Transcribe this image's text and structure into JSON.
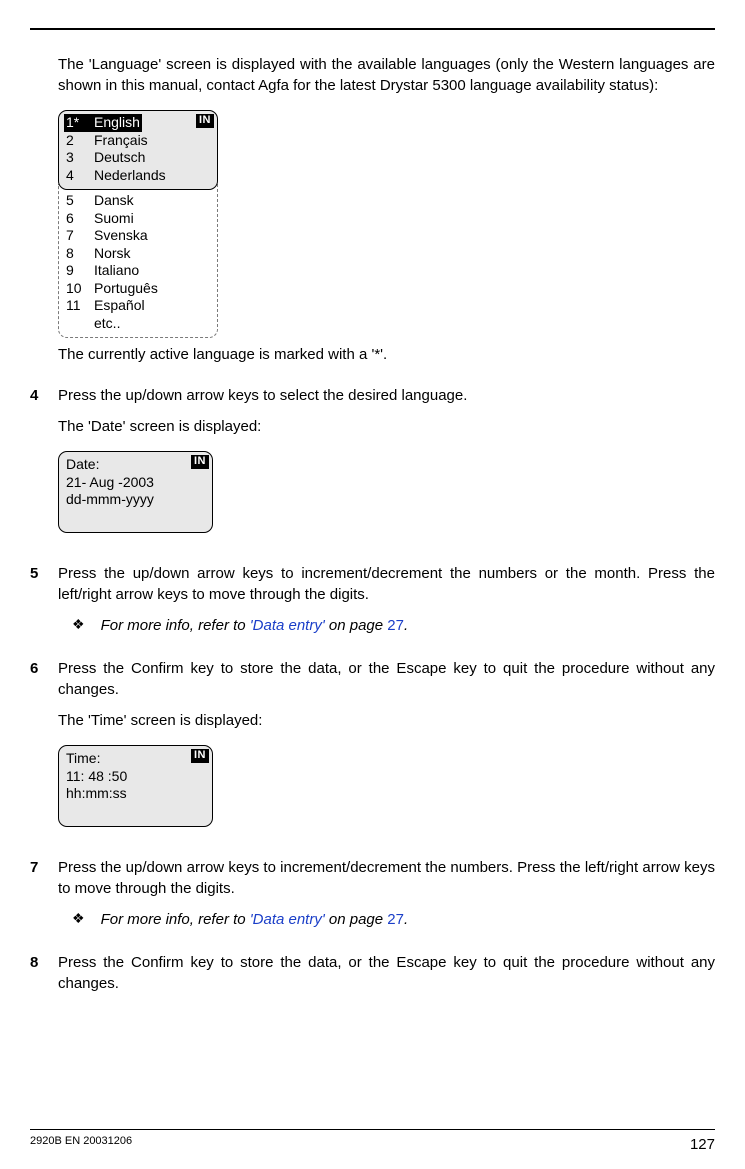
{
  "intro_para": "The 'Language' screen is displayed with the available languages (only the Western languages are shown in this manual, contact Agfa for the latest Drystar 5300 language availability status):",
  "lang_badge": "IN",
  "lang_box": {
    "visible": [
      {
        "num": "1*",
        "name": "English",
        "selected": true
      },
      {
        "num": "2",
        "name": "Français",
        "selected": false
      },
      {
        "num": "3",
        "name": "Deutsch",
        "selected": false
      },
      {
        "num": "4",
        "name": "Nederlands",
        "selected": false
      }
    ],
    "hidden": [
      {
        "num": "5",
        "name": "Dansk"
      },
      {
        "num": "6",
        "name": "Suomi"
      },
      {
        "num": "7",
        "name": "Svenska"
      },
      {
        "num": "8",
        "name": "Norsk"
      },
      {
        "num": "9",
        "name": "Italiano"
      },
      {
        "num": "10",
        "name": "Português"
      },
      {
        "num": "11",
        "name": "Español"
      },
      {
        "num": "",
        "name": "etc.."
      }
    ]
  },
  "after_lang": "The currently active language is marked with a '*'.",
  "steps": {
    "s4": {
      "num": "4",
      "text": "Press the up/down arrow keys to select the desired language.",
      "follow": "The 'Date' screen is displayed:"
    },
    "s5": {
      "num": "5",
      "text": "Press the up/down arrow keys to increment/decrement the numbers or the month. Press the left/right arrow keys to move through the digits."
    },
    "s6": {
      "num": "6",
      "text": "Press the Confirm key to store the data, or the Escape key to quit the procedure without any changes.",
      "follow": "The 'Time' screen is displayed:"
    },
    "s7": {
      "num": "7",
      "text": "Press the up/down arrow keys to increment/decrement the numbers. Press the left/right arrow keys to move through the digits."
    },
    "s8": {
      "num": "8",
      "text": "Press the Confirm key to store the data, or the Escape key to quit the procedure without any changes."
    }
  },
  "date_box": {
    "l1": "Date:",
    "l2": "21- Aug -2003",
    "l3": "dd-mmm-yyyy",
    "badge": "IN"
  },
  "time_box": {
    "l1": "Time:",
    "l2": "11: 48 :50",
    "l3": "hh:mm:ss",
    "badge": "IN"
  },
  "hint_prefix": "For more info, refer to ",
  "hint_link": "'Data entry'",
  "hint_mid": " on page ",
  "hint_page": "27",
  "hint_suffix": ".",
  "footer_left": "2920B EN 20031206",
  "footer_right": "127"
}
